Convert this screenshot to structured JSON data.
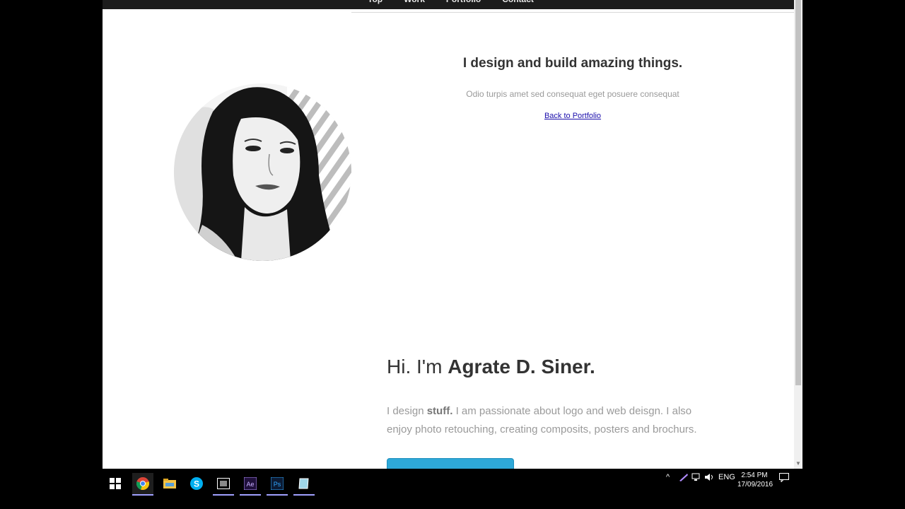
{
  "nav": {
    "items": [
      "Top",
      "Work",
      "Portfolio",
      "Contact"
    ]
  },
  "banner": {
    "title": "I design and build amazing things.",
    "subtitle": "Odio turpis amet sed consequat eget posuere consequat",
    "back_link": "Back to Portfolio"
  },
  "intro": {
    "greeting": "Hi. I'm",
    "name": "Agrate D. Siner.",
    "about_pre": "I design",
    "about_bold": "stuff.",
    "about_post": "I am passionate about logo and web deisgn. I also enjoy photo retouching, creating composits, posters and brochurs."
  },
  "taskbar": {
    "apps": [
      "start-icon",
      "chrome-icon",
      "file-explorer-icon",
      "skype-icon",
      "media-app-icon",
      "after-effects-icon",
      "photoshop-icon",
      "notes-app-icon"
    ],
    "tray_language": "ENG",
    "clock_time": "2:54 PM",
    "clock_date": "17/09/2016"
  },
  "colors": {
    "accent": "#2ea8d8",
    "nav_bg": "#1c1c1c",
    "link": "#1a0dab"
  }
}
